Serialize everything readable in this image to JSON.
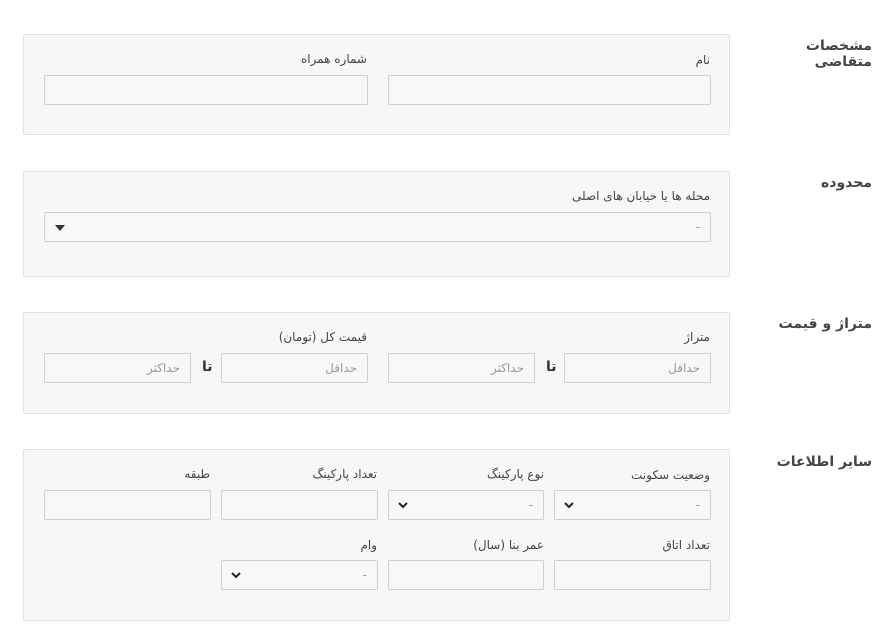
{
  "sections": {
    "applicant": {
      "title": "مشخصات متقاضی",
      "name_label": "نام",
      "mobile_label": "شماره همراه"
    },
    "area": {
      "title": "محدوده",
      "streets_label": "محله ها یا خیابان های اصلی",
      "streets_value": "-"
    },
    "size_price": {
      "title": "متراژ و قیمت",
      "area_label": "متراژ",
      "price_label": "قیمت کل (تومان)",
      "min_placeholder": "حداقل",
      "max_placeholder": "حداکثر",
      "to_label": "تا"
    },
    "other": {
      "title": "سایر اطلاعات",
      "residence_label": "وضعیت سکونت",
      "residence_value": "-",
      "parking_type_label": "نوع پارکینگ",
      "parking_type_value": "-",
      "parking_count_label": "تعداد پارکینگ",
      "floor_label": "طبقه",
      "rooms_label": "تعداد اتاق",
      "age_label": "عمر بنا (سال)",
      "loan_label": "وام",
      "loan_value": "-"
    }
  }
}
